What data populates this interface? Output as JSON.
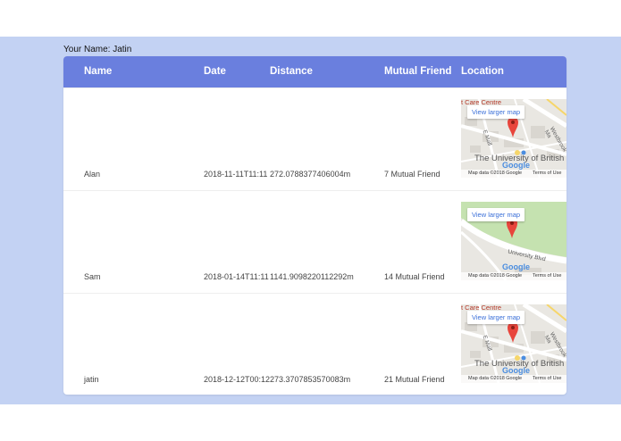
{
  "user": {
    "label": "Your Name: Jatin"
  },
  "table": {
    "headers": [
      "Name",
      "Date",
      "Distance",
      "Mutual Friend",
      "Location"
    ],
    "rows": [
      {
        "name": "Alan",
        "date": "2018-11-11T11:11",
        "distance": "272.0788377406004m",
        "mutual": "7 Mutual Friend",
        "map": {
          "link": "View larger map",
          "poi": "t Care Centre",
          "place": "The University of British",
          "footer_data": "Map data ©2018 Google",
          "footer_terms": "Terms of Use",
          "street": "Westbrook Ma",
          "lane": "E Mall",
          "logo": "Google"
        }
      },
      {
        "name": "Sam",
        "date": "2018-01-14T11:11",
        "distance": "1141.9098220112292m",
        "mutual": "14 Mutual Friend",
        "map": {
          "link": "View larger map",
          "road": "University Blvd",
          "logo": "Google",
          "footer_data": "Map data ©2018 Google",
          "footer_terms": "Terms of Use"
        }
      },
      {
        "name": "jatin",
        "date": "2018-12-12T00:12",
        "distance": "273.3707853570083m",
        "mutual": "21 Mutual Friend",
        "map": {
          "link": "View larger map",
          "poi": "t Care Centre",
          "place": "The University of British",
          "footer_data": "Map data ©2018 Google",
          "footer_terms": "Terms of Use",
          "street": "Westbrook Ma",
          "lane": "E Mall",
          "logo": "Google"
        }
      }
    ]
  },
  "colors": {
    "background_band": "#c3d2f3",
    "header": "#6a7fde",
    "map_park": "#c5e2b0",
    "pin": "#e8453c"
  }
}
